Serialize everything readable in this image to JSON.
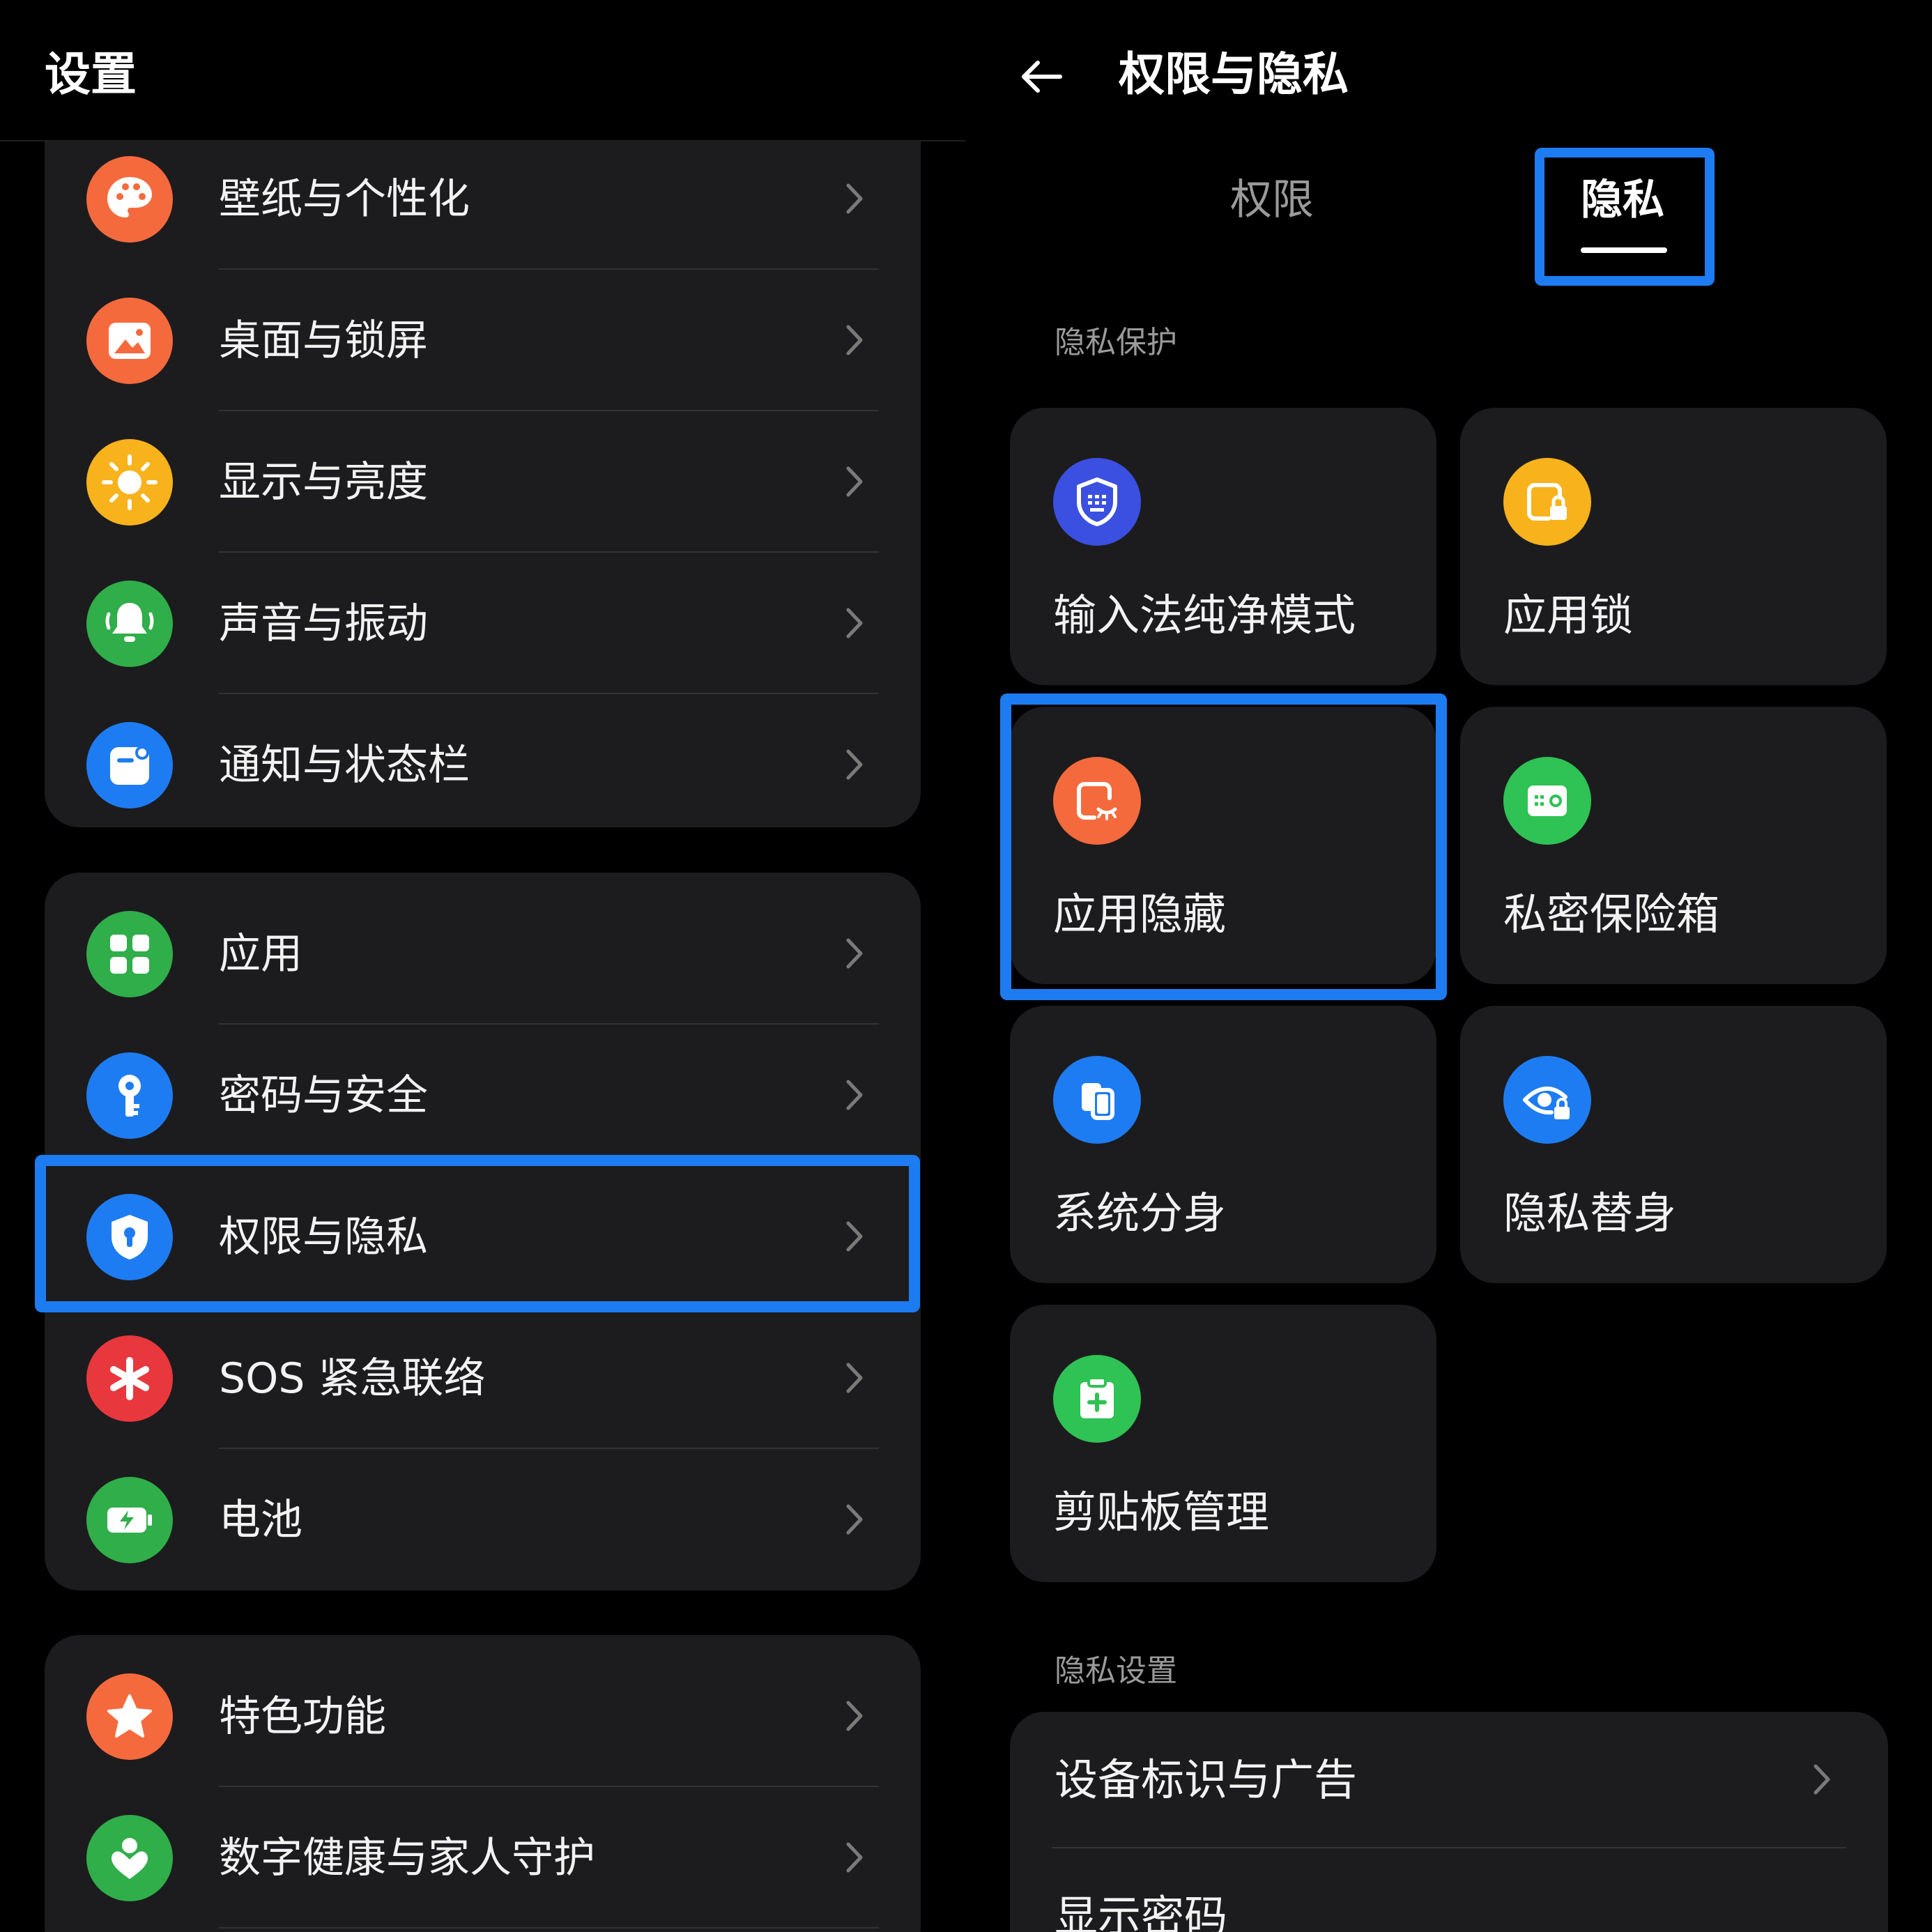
{
  "left": {
    "title": "设置",
    "items_group1": [
      {
        "label": "壁纸与个性化",
        "icon": "palette-icon",
        "color": "#f56a3d"
      },
      {
        "label": "桌面与锁屏",
        "icon": "picture-icon",
        "color": "#f56a3d"
      },
      {
        "label": "显示与亮度",
        "icon": "sun-icon",
        "color": "#f7b21c"
      },
      {
        "label": "声音与振动",
        "icon": "bell-icon",
        "color": "#2fae4a"
      },
      {
        "label": "通知与状态栏",
        "icon": "notification-icon",
        "color": "#1e7cf2"
      }
    ],
    "items_group2": [
      {
        "label": "应用",
        "icon": "apps-grid-icon",
        "color": "#2fae4a"
      },
      {
        "label": "密码与安全",
        "icon": "key-icon",
        "color": "#1e7cf2"
      },
      {
        "label": "权限与隐私",
        "icon": "shield-icon",
        "color": "#1e7cf2"
      },
      {
        "label": "SOS 紧急联络",
        "icon": "asterisk-icon",
        "color": "#e8383d"
      },
      {
        "label": "电池",
        "icon": "battery-icon",
        "color": "#2fae4a"
      }
    ],
    "items_group3": [
      {
        "label": "特色功能",
        "icon": "star-icon",
        "color": "#f56a3d"
      },
      {
        "label": "数字健康与家人守护",
        "icon": "heart-person-icon",
        "color": "#2fae4a"
      }
    ]
  },
  "right": {
    "title": "权限与隐私",
    "tabs": [
      {
        "label": "权限",
        "active": false
      },
      {
        "label": "隐私",
        "active": true
      }
    ],
    "section_protection": "隐私保护",
    "cards": [
      {
        "label": "输入法纯净模式",
        "icon": "keyboard-shield-icon",
        "color": "#3b4fe0"
      },
      {
        "label": "应用锁",
        "icon": "app-lock-icon",
        "color": "#f7b21c"
      },
      {
        "label": "应用隐藏",
        "icon": "app-hide-icon",
        "color": "#f56a3d"
      },
      {
        "label": "私密保险箱",
        "icon": "safe-icon",
        "color": "#2fc254"
      },
      {
        "label": "系统分身",
        "icon": "clone-icon",
        "color": "#1e7cf2"
      },
      {
        "label": "隐私替身",
        "icon": "eye-lock-icon",
        "color": "#1e7cf2"
      },
      {
        "label": "剪贴板管理",
        "icon": "clipboard-icon",
        "color": "#2fc254"
      }
    ],
    "section_settings": "隐私设置",
    "settings": [
      {
        "label": "设备标识与广告"
      },
      {
        "label": "显示密码",
        "toggle": true
      }
    ]
  },
  "accent": "#1e7cf2"
}
